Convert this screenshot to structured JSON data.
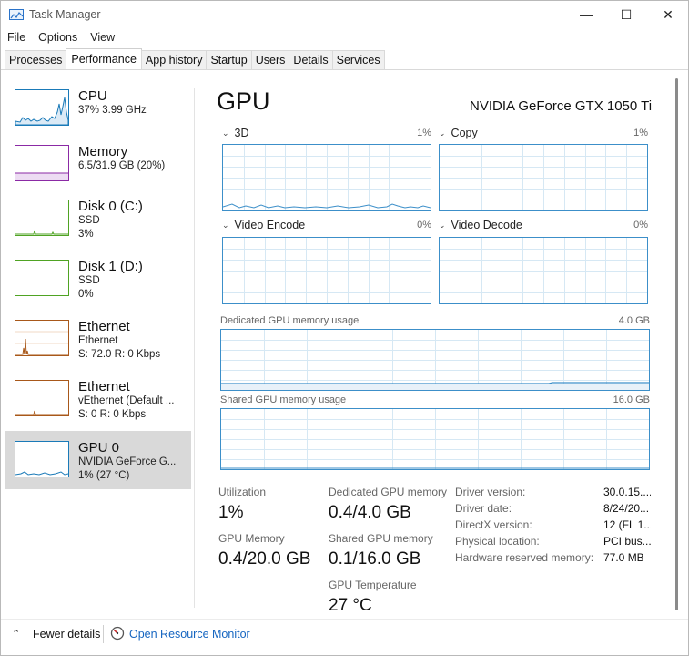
{
  "window": {
    "title": "Task Manager",
    "minimize_glyph": "—",
    "maximize_glyph": "☐",
    "close_glyph": "✕"
  },
  "menu": [
    "File",
    "Options",
    "View"
  ],
  "tabs": [
    {
      "label": "Processes",
      "active": false
    },
    {
      "label": "Performance",
      "active": true
    },
    {
      "label": "App history",
      "active": false
    },
    {
      "label": "Startup",
      "active": false
    },
    {
      "label": "Users",
      "active": false
    },
    {
      "label": "Details",
      "active": false
    },
    {
      "label": "Services",
      "active": false
    }
  ],
  "sidebar": {
    "items": [
      {
        "title": "CPU",
        "sub1": "37% 3.99 GHz",
        "sub2": "",
        "color": "#1a7ab8"
      },
      {
        "title": "Memory",
        "sub1": "6.5/31.9 GB (20%)",
        "sub2": "",
        "color": "#8b2aa5"
      },
      {
        "title": "Disk 0 (C:)",
        "sub1": "SSD",
        "sub2": "3%",
        "color": "#4fa323"
      },
      {
        "title": "Disk 1 (D:)",
        "sub1": "SSD",
        "sub2": "0%",
        "color": "#4fa323"
      },
      {
        "title": "Ethernet",
        "sub1": "Ethernet",
        "sub2": "S: 72.0  R: 0 Kbps",
        "color": "#a8581a"
      },
      {
        "title": "Ethernet",
        "sub1": "vEthernet (Default ...",
        "sub2": "S: 0  R: 0 Kbps",
        "color": "#a8581a"
      },
      {
        "title": "GPU 0",
        "sub1": "NVIDIA GeForce G...",
        "sub2": "1% (27 °C)",
        "color": "#1a7ab8"
      }
    ]
  },
  "gpu": {
    "title": "GPU",
    "model": "NVIDIA GeForce GTX 1050 Ti",
    "engines": [
      {
        "name": "3D",
        "pct": "1%"
      },
      {
        "name": "Copy",
        "pct": "1%"
      },
      {
        "name": "Video Encode",
        "pct": "0%"
      },
      {
        "name": "Video Decode",
        "pct": "0%"
      }
    ],
    "dedicated_mem": {
      "label": "Dedicated GPU memory usage",
      "max": "4.0 GB"
    },
    "shared_mem": {
      "label": "Shared GPU memory usage",
      "max": "16.0 GB"
    },
    "stats": {
      "utilization_label": "Utilization",
      "utilization_value": "1%",
      "gpu_memory_label": "GPU Memory",
      "gpu_memory_value": "0.4/20.0 GB",
      "dedicated_label": "Dedicated GPU memory",
      "dedicated_value": "0.4/4.0 GB",
      "shared_label": "Shared GPU memory",
      "shared_value": "0.1/16.0 GB",
      "temp_label": "GPU Temperature",
      "temp_value": "27 °C"
    },
    "details": [
      {
        "key": "Driver version:",
        "value": "30.0.15...."
      },
      {
        "key": "Driver date:",
        "value": "8/24/20..."
      },
      {
        "key": "DirectX version:",
        "value": "12 (FL 1..."
      },
      {
        "key": "Physical location:",
        "value": "PCI bus..."
      },
      {
        "key": "Hardware reserved memory:",
        "value": "77.0 MB"
      }
    ]
  },
  "footer": {
    "fewer_details": "Fewer details",
    "open_monitor": "Open Resource Monitor"
  },
  "colors": {
    "gpu_line": "#3c8fc9",
    "grid": "#d6e8f4",
    "link": "#1565c0"
  }
}
